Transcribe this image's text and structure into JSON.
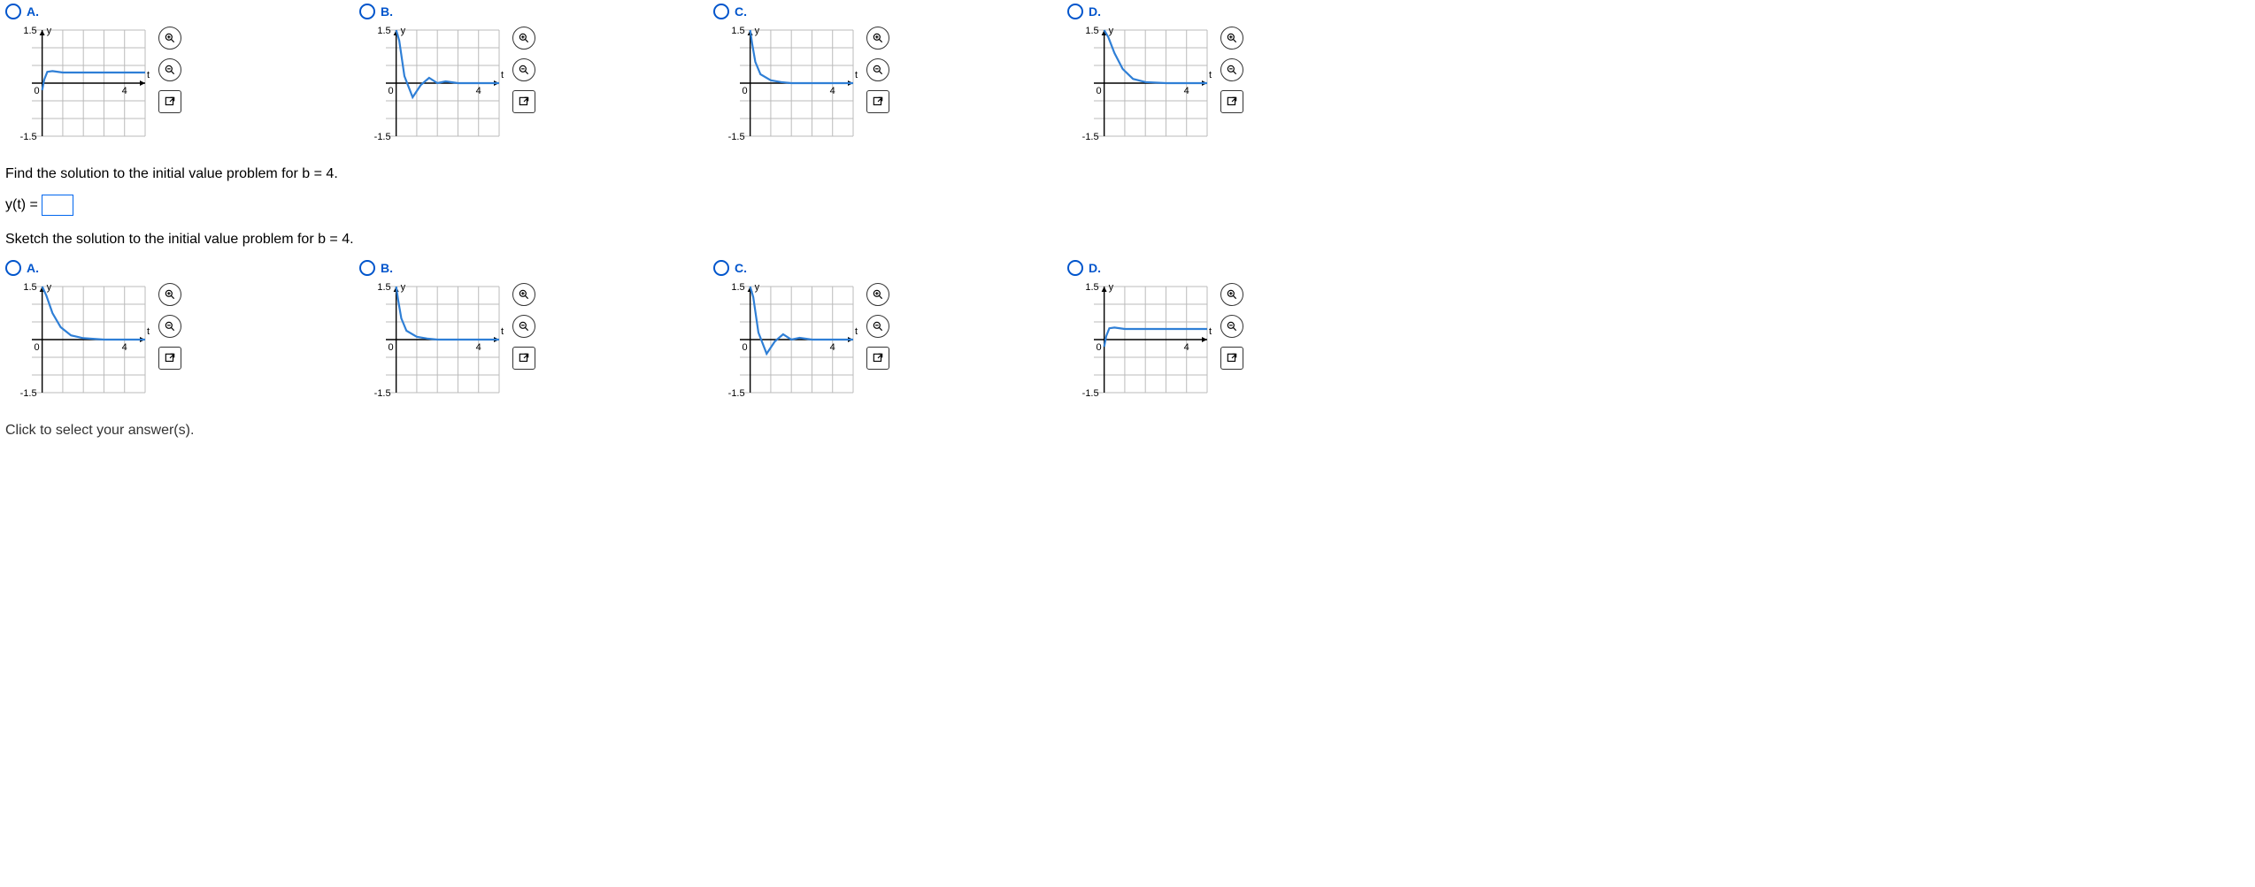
{
  "row1": {
    "choices": [
      {
        "label": "A."
      },
      {
        "label": "B."
      },
      {
        "label": "C."
      },
      {
        "label": "D."
      }
    ]
  },
  "instr1": "Find the solution to the initial value problem for b = 4.",
  "eq_lhs": "y(t) =",
  "instr2": "Sketch the solution to the initial value problem for b = 4.",
  "row2": {
    "choices": [
      {
        "label": "A."
      },
      {
        "label": "B."
      },
      {
        "label": "C."
      },
      {
        "label": "D."
      }
    ]
  },
  "footer": "Click to select your answer(s).",
  "graph_labels": {
    "y_top": "1.5",
    "y_bot": "-1.5",
    "y_axis": "y",
    "x_axis": "t",
    "x_zero": "0",
    "x_tick": "4"
  },
  "chart_data": [
    {
      "id": "row1-A",
      "type": "line",
      "title": "",
      "xlabel": "t",
      "ylabel": "y",
      "xlim": [
        -0.5,
        5
      ],
      "ylim": [
        -1.5,
        1.5
      ],
      "x": [
        0,
        0.1,
        0.25,
        0.5,
        1,
        1.5,
        2,
        3,
        4,
        5
      ],
      "y": [
        -0.2,
        0.1,
        0.32,
        0.34,
        0.3,
        0.3,
        0.3,
        0.3,
        0.3,
        0.3
      ]
    },
    {
      "id": "row1-B",
      "type": "line",
      "title": "",
      "xlabel": "t",
      "ylabel": "y",
      "xlim": [
        -0.5,
        5
      ],
      "ylim": [
        -1.5,
        1.5
      ],
      "x": [
        0,
        0.15,
        0.4,
        0.8,
        1.2,
        1.6,
        2.0,
        2.4,
        3.0,
        4.0,
        5.0
      ],
      "y": [
        1.5,
        1.2,
        0.2,
        -0.4,
        -0.05,
        0.15,
        0.0,
        0.05,
        0.0,
        0.0,
        0.0
      ]
    },
    {
      "id": "row1-C",
      "type": "line",
      "title": "",
      "xlabel": "t",
      "ylabel": "y",
      "xlim": [
        -0.5,
        5
      ],
      "ylim": [
        -1.5,
        1.5
      ],
      "x": [
        0,
        0.1,
        0.25,
        0.5,
        1.0,
        1.5,
        2,
        3,
        4,
        5
      ],
      "y": [
        1.5,
        1.1,
        0.6,
        0.25,
        0.08,
        0.03,
        0.0,
        0.0,
        0.0,
        0.0
      ]
    },
    {
      "id": "row1-D",
      "type": "line",
      "title": "",
      "xlabel": "t",
      "ylabel": "y",
      "xlim": [
        -0.5,
        5
      ],
      "ylim": [
        -1.5,
        1.5
      ],
      "x": [
        0,
        0.2,
        0.5,
        0.9,
        1.4,
        2.0,
        3.0,
        4.0,
        5.0
      ],
      "y": [
        1.5,
        1.3,
        0.85,
        0.4,
        0.12,
        0.03,
        0.0,
        0.0,
        0.0
      ]
    },
    {
      "id": "row2-A",
      "type": "line",
      "title": "",
      "xlabel": "t",
      "ylabel": "y",
      "xlim": [
        -0.5,
        5
      ],
      "ylim": [
        -1.5,
        1.5
      ],
      "x": [
        0,
        0.2,
        0.5,
        0.9,
        1.4,
        2.0,
        3.0,
        4.0,
        5.0
      ],
      "y": [
        1.5,
        1.25,
        0.75,
        0.35,
        0.12,
        0.04,
        0.0,
        0.0,
        0.0
      ]
    },
    {
      "id": "row2-B",
      "type": "line",
      "title": "",
      "xlabel": "t",
      "ylabel": "y",
      "xlim": [
        -0.5,
        5
      ],
      "ylim": [
        -1.5,
        1.5
      ],
      "x": [
        0,
        0.1,
        0.25,
        0.5,
        1.0,
        1.5,
        2,
        3,
        4,
        5
      ],
      "y": [
        1.5,
        1.1,
        0.6,
        0.25,
        0.08,
        0.03,
        0.0,
        0.0,
        0.0,
        0.0
      ]
    },
    {
      "id": "row2-C",
      "type": "line",
      "title": "",
      "xlabel": "t",
      "ylabel": "y",
      "xlim": [
        -0.5,
        5
      ],
      "ylim": [
        -1.5,
        1.5
      ],
      "x": [
        0,
        0.15,
        0.4,
        0.8,
        1.2,
        1.6,
        2.0,
        2.4,
        3.0,
        4.0,
        5.0
      ],
      "y": [
        1.5,
        1.2,
        0.2,
        -0.4,
        -0.05,
        0.15,
        0.0,
        0.05,
        0.0,
        0.0,
        0.0
      ]
    },
    {
      "id": "row2-D",
      "type": "line",
      "title": "",
      "xlabel": "t",
      "ylabel": "y",
      "xlim": [
        -0.5,
        5
      ],
      "ylim": [
        -1.5,
        1.5
      ],
      "x": [
        0,
        0.1,
        0.25,
        0.5,
        1,
        1.5,
        2,
        3,
        4,
        5
      ],
      "y": [
        -0.2,
        0.1,
        0.32,
        0.34,
        0.3,
        0.3,
        0.3,
        0.3,
        0.3,
        0.3
      ]
    }
  ]
}
